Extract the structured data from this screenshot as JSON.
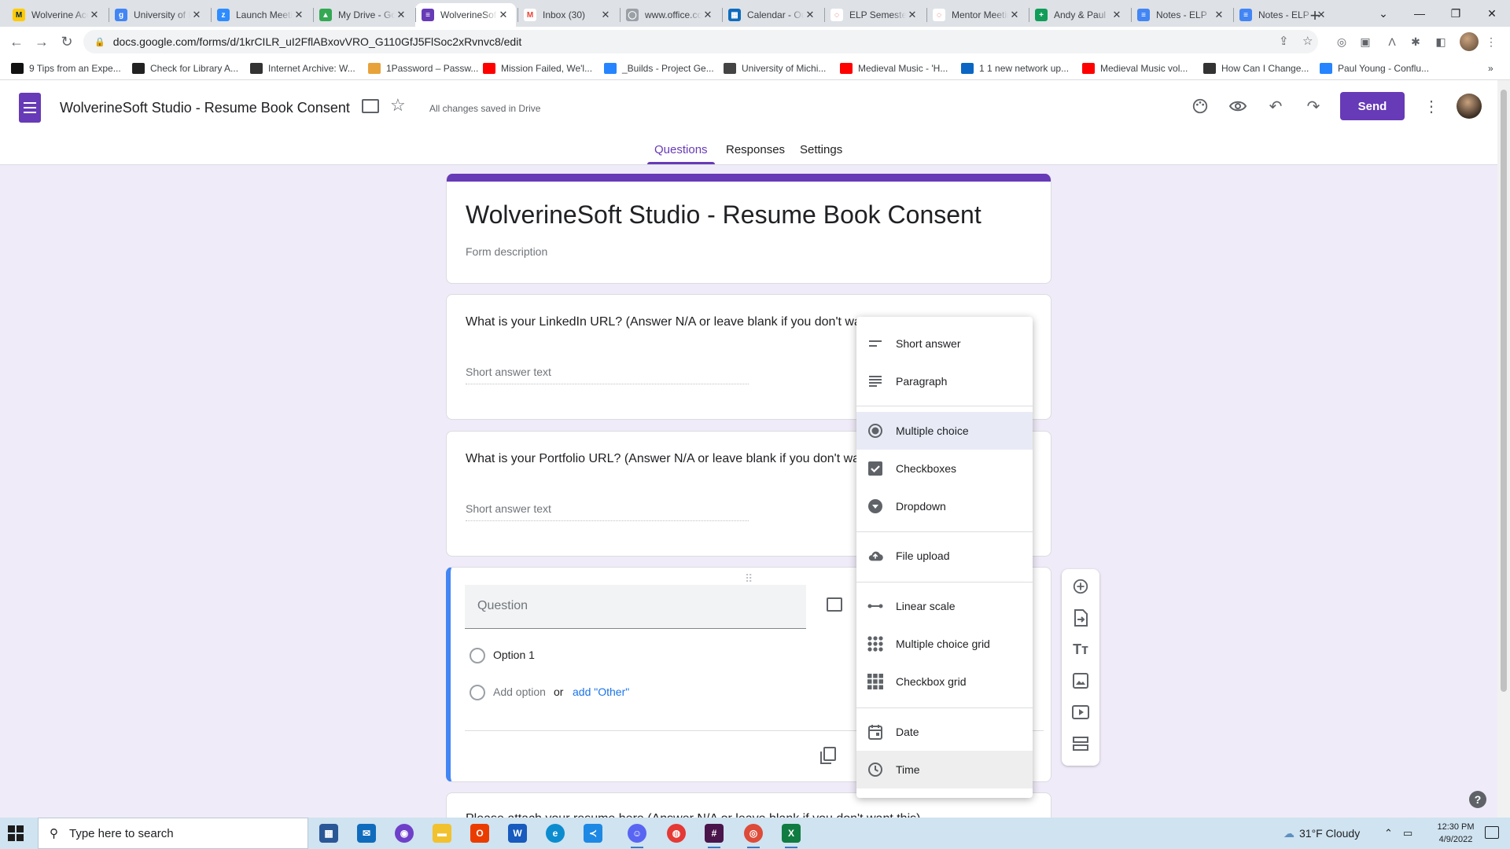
{
  "browser": {
    "tabs": [
      {
        "title": "Wolverine Access",
        "icon_letter": "M",
        "icon_color": "#ffcb05",
        "icon_text_color": "#00274c"
      },
      {
        "title": "University of Michigan",
        "icon_letter": "g",
        "icon_color": "#4285f4",
        "icon_text_color": "#ffffff"
      },
      {
        "title": "Launch Meeting - Zoom",
        "icon_letter": "z",
        "icon_color": "#2d8cff",
        "icon_text_color": "#ffffff"
      },
      {
        "title": "My Drive - Google Drive",
        "icon_letter": "▲",
        "icon_color": "#34a853",
        "icon_text_color": "#ffffff"
      },
      {
        "title": "WolverineSoft Studio",
        "icon_letter": "≡",
        "icon_color": "#673ab7",
        "icon_text_color": "#ffffff"
      },
      {
        "title": "Inbox (30)",
        "icon_letter": "M",
        "icon_color": "#ffffff",
        "icon_text_color": "#ea4335"
      },
      {
        "title": "www.office.com",
        "icon_letter": "◯",
        "icon_color": "#9aa0a6",
        "icon_text_color": "#ffffff"
      },
      {
        "title": "Calendar - Outlook",
        "icon_letter": "▦",
        "icon_color": "#0f6cbd",
        "icon_text_color": "#ffffff"
      },
      {
        "title": "ELP Semester",
        "icon_letter": "◌",
        "icon_color": "#ffffff",
        "icon_text_color": "#d93025"
      },
      {
        "title": "Mentor Meeting",
        "icon_letter": "◌",
        "icon_color": "#ffffff",
        "icon_text_color": "#d93025"
      },
      {
        "title": "Andy & Paul",
        "icon_letter": "+",
        "icon_color": "#0f9d58",
        "icon_text_color": "#ffffff"
      },
      {
        "title": "Notes - ELP",
        "icon_letter": "≡",
        "icon_color": "#4285f4",
        "icon_text_color": "#ffffff"
      },
      {
        "title": "Notes - ELP",
        "icon_letter": "≡",
        "icon_color": "#4285f4",
        "icon_text_color": "#ffffff"
      }
    ],
    "active_tab_index": 4,
    "url": "docs.google.com/forms/d/1krCILR_uI2FflABxovVRO_G110GfJ5FlSoc2xRvnvc8/edit",
    "bookmarks": [
      {
        "label": "9 Tips from an Expe...",
        "color": "#111111"
      },
      {
        "label": "Check for Library A...",
        "color": "#222222"
      },
      {
        "label": "Internet Archive: W...",
        "color": "#333333"
      },
      {
        "label": "1Password – Passw...",
        "color": "#e8a23a"
      },
      {
        "label": "Mission Failed, We'l...",
        "color": "#ff0000"
      },
      {
        "label": "_Builds - Project Ge...",
        "color": "#2684ff"
      },
      {
        "label": "University of Michi...",
        "color": "#444444"
      },
      {
        "label": "Medieval Music - 'H...",
        "color": "#ff0000"
      },
      {
        "label": "1 1 new network up...",
        "color": "#0a66c2"
      },
      {
        "label": "Medieval Music vol...",
        "color": "#ff0000"
      },
      {
        "label": "How Can I Change...",
        "color": "#333333"
      },
      {
        "label": "Paul Young - Conflu...",
        "color": "#2684ff"
      }
    ]
  },
  "forms": {
    "doc_title": "WolverineSoft Studio - Resume Book Consent",
    "save_status": "All changes saved in Drive",
    "send_label": "Send",
    "tabs": [
      "Questions",
      "Responses",
      "Settings"
    ],
    "active_tab": "Questions",
    "accent": "#673ab7",
    "form_title": "WolverineSoft Studio - Resume Book Consent",
    "form_description": "Form description",
    "questions": [
      {
        "text": "What is your LinkedIn URL? (Answer N/A or leave blank if you don't wa",
        "placeholder": "Short answer text"
      },
      {
        "text": "What is your Portfolio URL? (Answer N/A or leave blank if you don't wa",
        "placeholder": "Short answer text"
      }
    ],
    "editing_question": {
      "placeholder": "Question",
      "option_1": "Option 1",
      "add_option": "Add option",
      "or": "or",
      "add_other": "add \"Other\""
    },
    "next_question_partial": "Please attach your resume here (Answer N/A or leave blank if you don't want this)"
  },
  "type_menu": {
    "items": [
      {
        "label": "Short answer",
        "icon": "short-answer-icon"
      },
      {
        "label": "Paragraph",
        "icon": "paragraph-icon"
      },
      {
        "label": "Multiple choice",
        "icon": "radio-icon",
        "selected": true
      },
      {
        "label": "Checkboxes",
        "icon": "checkbox-icon"
      },
      {
        "label": "Dropdown",
        "icon": "dropdown-icon"
      },
      {
        "label": "File upload",
        "icon": "upload-icon"
      },
      {
        "label": "Linear scale",
        "icon": "linear-scale-icon"
      },
      {
        "label": "Multiple choice grid",
        "icon": "mc-grid-icon"
      },
      {
        "label": "Checkbox grid",
        "icon": "checkbox-grid-icon"
      },
      {
        "label": "Date",
        "icon": "calendar-icon"
      },
      {
        "label": "Time",
        "icon": "clock-icon",
        "hovered": true
      }
    ]
  },
  "taskbar": {
    "search_placeholder": "Type here to search",
    "weather": "31°F  Cloudy",
    "time": "12:30 PM",
    "date": "4/9/2022"
  }
}
